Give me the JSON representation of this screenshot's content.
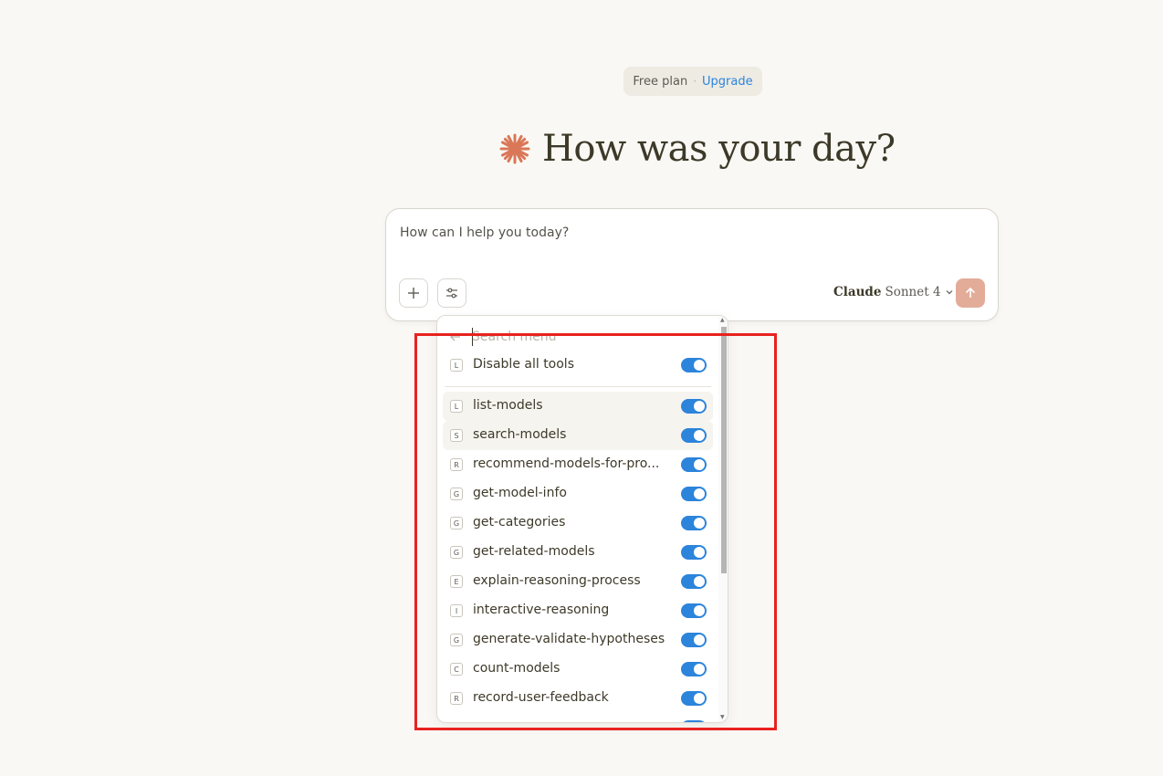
{
  "plan": {
    "label": "Free plan",
    "separator": "·",
    "upgrade": "Upgrade"
  },
  "greeting": {
    "title": "How was your day?"
  },
  "composer": {
    "placeholder": "How can I help you today?",
    "model_name": "Claude",
    "model_version": "Sonnet 4"
  },
  "tools_menu": {
    "search_placeholder": "Search menu",
    "disable_all": {
      "badge": "L",
      "label": "Disable all tools",
      "enabled": true
    },
    "tools": [
      {
        "badge": "L",
        "label": "list-models",
        "enabled": true
      },
      {
        "badge": "S",
        "label": "search-models",
        "enabled": true
      },
      {
        "badge": "R",
        "label": "recommend-models-for-pro...",
        "enabled": true
      },
      {
        "badge": "G",
        "label": "get-model-info",
        "enabled": true
      },
      {
        "badge": "G",
        "label": "get-categories",
        "enabled": true
      },
      {
        "badge": "G",
        "label": "get-related-models",
        "enabled": true
      },
      {
        "badge": "E",
        "label": "explain-reasoning-process",
        "enabled": true
      },
      {
        "badge": "I",
        "label": "interactive-reasoning",
        "enabled": true
      },
      {
        "badge": "G",
        "label": "generate-validate-hypotheses",
        "enabled": true
      },
      {
        "badge": "C",
        "label": "count-models",
        "enabled": true
      },
      {
        "badge": "R",
        "label": "record-user-feedback",
        "enabled": true
      },
      {
        "badge": "",
        "label": "",
        "enabled": true
      }
    ]
  },
  "colors": {
    "accent": "#2c84db",
    "brand": "#d97757",
    "send_button": "#e3ac98",
    "highlight": "#e8221f",
    "background": "#faf8f4"
  },
  "icons": {
    "logo": "claude-starburst-icon",
    "add": "plus-icon",
    "tools": "sliders-icon",
    "model_dropdown": "chevron-down-icon",
    "send": "arrow-up-icon",
    "back": "arrow-left-icon"
  }
}
